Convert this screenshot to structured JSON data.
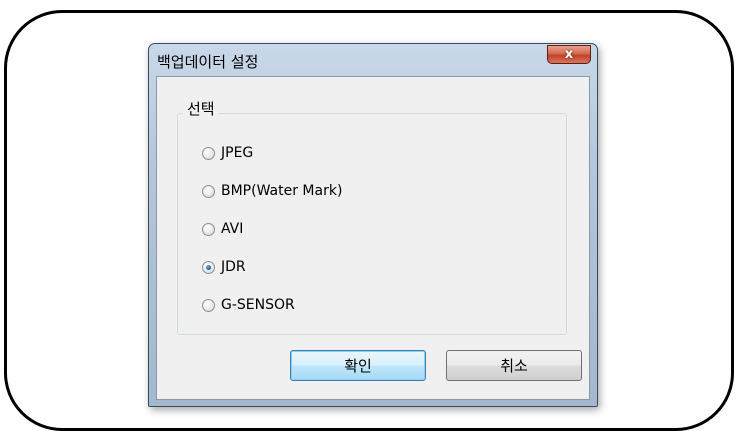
{
  "dialog": {
    "title": "백업데이터 설정",
    "close_glyph": "x"
  },
  "group": {
    "label": "선택",
    "options": [
      {
        "label": "JPEG",
        "checked": false
      },
      {
        "label": "BMP(Water Mark)",
        "checked": false
      },
      {
        "label": "AVI",
        "checked": false
      },
      {
        "label": "JDR",
        "checked": true
      },
      {
        "label": "G-SENSOR",
        "checked": false
      }
    ],
    "selected": "JDR"
  },
  "buttons": {
    "ok_label": "확인",
    "cancel_label": "취소"
  },
  "colors": {
    "close_button": "#c2412a",
    "selected_radio": "#1d5fa8",
    "default_button_border": "#3c7fb1"
  }
}
